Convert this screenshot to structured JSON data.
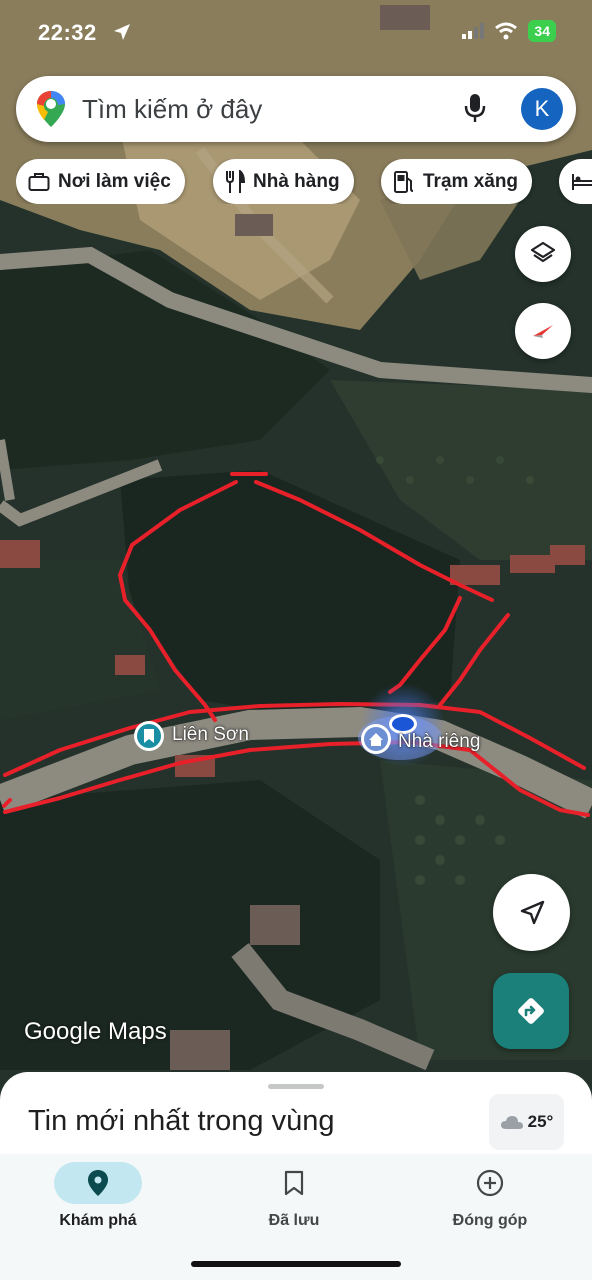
{
  "status_bar": {
    "time": "22:32",
    "battery": "34"
  },
  "search": {
    "placeholder": "Tìm kiếm ở đây",
    "avatar_letter": "K"
  },
  "chips": [
    {
      "label": "Nơi làm việc",
      "icon": "briefcase-icon"
    },
    {
      "label": "Nhà hàng",
      "icon": "restaurant-icon"
    },
    {
      "label": "Trạm xăng",
      "icon": "gas-station-icon"
    },
    {
      "label": "",
      "icon": "hotel-icon"
    }
  ],
  "map": {
    "labels": {
      "place_1": "Liên Sơn",
      "place_2": "Nhà riêng"
    },
    "attribution": "Google Maps",
    "colors": {
      "drawing": "#e8202a",
      "location_dot": "#1a56d6",
      "accent": "#1a8079"
    }
  },
  "sheet": {
    "title": "Tin mới nhất trong vùng",
    "weather_temp": "25°"
  },
  "nav": {
    "explore": "Khám phá",
    "saved": "Đã lưu",
    "contribute": "Đóng góp"
  }
}
